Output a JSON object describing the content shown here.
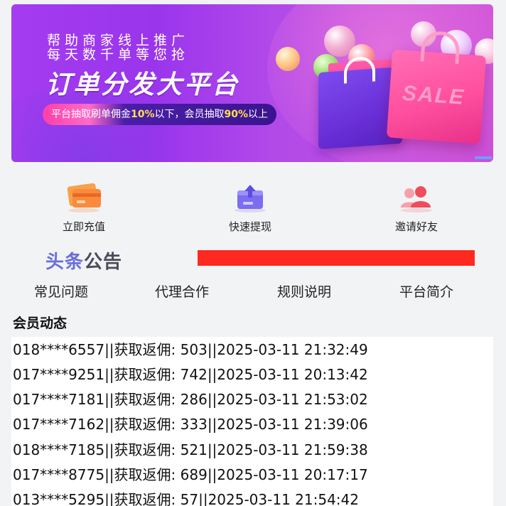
{
  "banner": {
    "line1": "帮助商家线上推广",
    "line2": "每天数千单等您抢",
    "title": "订单分发大平台",
    "pill_prefix": "平台抽取刷单佣金",
    "pill_rate1": "10%",
    "pill_mid": "以下，会员抽取",
    "pill_rate2": "90%",
    "pill_suffix": "以上",
    "bag_text": "SALE"
  },
  "actions": [
    {
      "label": "立即充值",
      "icon": "credit-card-icon"
    },
    {
      "label": "快速提现",
      "icon": "withdraw-upload-icon"
    },
    {
      "label": "邀请好友",
      "icon": "invite-friends-icon"
    }
  ],
  "notice": {
    "logo_part1": "头条",
    "logo_part2": "公告",
    "text": ""
  },
  "links": [
    {
      "label": "常见问题"
    },
    {
      "label": "代理合作"
    },
    {
      "label": "规则说明"
    },
    {
      "label": "平台简介"
    }
  ],
  "member_activity": {
    "title": "会员动态",
    "rows": [
      "018****6557||获取返佣: 503||2025-03-11 21:32:49",
      "017****9251||获取返佣: 742||2025-03-11 20:13:42",
      "017****7181||获取返佣: 286||2025-03-11 21:53:02",
      "017****7162||获取返佣: 333||2025-03-11 21:39:06",
      "018****7185||获取返佣: 521||2025-03-11 21:59:38",
      "017****8775||获取返佣: 689||2025-03-11 20:17:17",
      "013****5295||获取返佣: 57||2025-03-11 21:54:42"
    ]
  },
  "colors": {
    "banner_purple": "#9a35ec",
    "pill_pink": "#ff3fa8",
    "highlight_yellow": "#ffe14d",
    "notice_red": "#ff2a1f",
    "logo_blue": "#6b6fd6"
  }
}
